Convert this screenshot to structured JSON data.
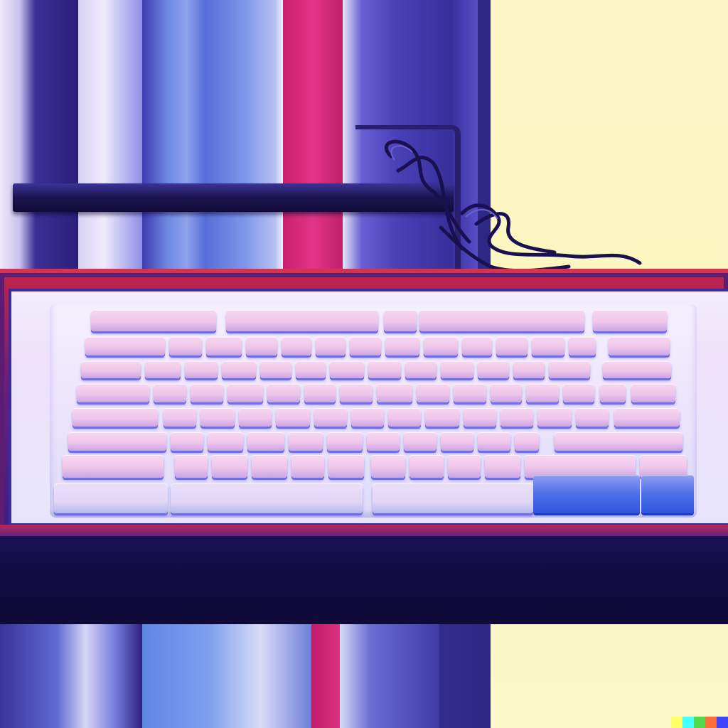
{
  "scene": {
    "description_tag": "",
    "colors": {
      "sky": "#fbf6c0",
      "pink_column": "#d1267a",
      "frame_red": "#c0244a",
      "dark_navy": "#120b42",
      "key_face": "#f0c6ea",
      "key_accent_blue": "#2f55e0"
    }
  },
  "keyboard": {
    "icon": "keyboard-icon"
  },
  "watermark": {
    "colors": [
      "#ffff66",
      "#42ffff",
      "#51da4c",
      "#ff6e3c",
      "#3c46ff"
    ]
  }
}
